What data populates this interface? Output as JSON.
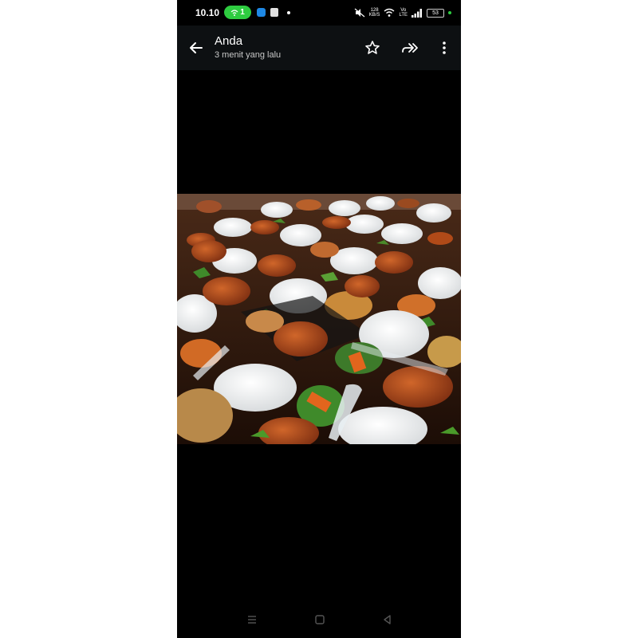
{
  "status_bar": {
    "time": "10.10",
    "hotspot_count": "1",
    "network_speed_value": "128",
    "network_speed_unit": "KB/S",
    "volte_top": "Vo",
    "volte_bottom": "LTE",
    "battery": "53",
    "charge_dot_color": "#2ecc40",
    "icons": [
      "hotspot-icon",
      "app-notification-icon",
      "shopping-bag-icon",
      "dot-icon",
      "mute-icon",
      "wifi-icon",
      "signal-icon",
      "battery-icon"
    ]
  },
  "app_bar": {
    "sender": "Anda",
    "timestamp": "3 menit yang lalu",
    "actions": [
      "back-arrow-icon",
      "star-icon",
      "forward-icon",
      "more-vert-icon"
    ]
  },
  "media": {
    "subject": "boxed meals with rice wrapped in paper, fried chicken and vegetables"
  },
  "nav_bar": {
    "buttons": [
      "recents-icon",
      "home-icon",
      "back-triangle-icon"
    ]
  }
}
